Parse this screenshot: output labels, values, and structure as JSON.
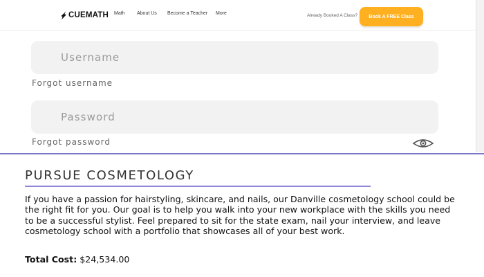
{
  "nav": {
    "logo_text": "CUEMATH",
    "links": [
      "Math",
      "About Us",
      "Become a Teacher",
      "More"
    ],
    "already_booked": "Already Booked A Class?",
    "cta_label": "Book A FREE Class"
  },
  "login": {
    "username_placeholder": "Username",
    "forgot_username": "Forgot username",
    "password_placeholder": "Password",
    "forgot_password": "Forgot password",
    "password_toggle_icon": "eye-icon"
  },
  "program": {
    "title": "PURSUE COSMETOLOGY",
    "description": "If you have a passion for hairstyling, skincare, and nails, our Danville cosmetology school could be the right fit for you. Our goal is to help you walk into your new workplace with the skills you need to be a successful stylist. Feel prepared to sit for the state exam, nail your interview, and leave cosmetology school with a portfolio that showcases all of your best work.",
    "cost_label": "Total Cost:",
    "cost_value": "$24,534.00"
  },
  "colors": {
    "cta_background": "#ffb020",
    "divider": "#7b78c9",
    "title_underline": "#8c86d6",
    "field_background": "#f2f2f2"
  }
}
